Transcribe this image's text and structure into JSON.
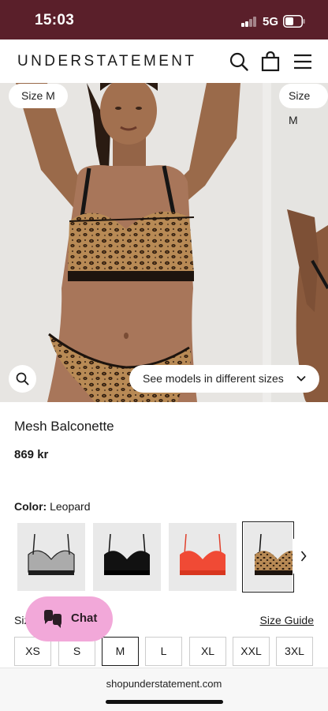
{
  "status_bar": {
    "time": "15:03",
    "network": "5G",
    "icons": [
      "signal-bars-icon",
      "battery-icon"
    ]
  },
  "header": {
    "brand": "UNDERSTATEMENT",
    "icons": [
      "search-icon",
      "shopping-bag-icon",
      "hamburger-menu-icon"
    ]
  },
  "gallery": {
    "slides": [
      {
        "size_tag": "Size M",
        "image": "model wearing leopard mesh balconette bra and briefs"
      },
      {
        "size_tag": "Size M",
        "image": "second model (partially visible)"
      }
    ],
    "zoom_icon": "magnifier-icon",
    "models_button": "See models in different sizes",
    "models_button_icon": "chevron-down-icon"
  },
  "product": {
    "name": "Mesh Balconette",
    "price": "869 kr",
    "color_label": "Color:",
    "color_value": "Leopard",
    "colors": [
      {
        "name": "Smoke",
        "hex": "#3a3a3a"
      },
      {
        "name": "Black",
        "hex": "#111111"
      },
      {
        "name": "Red",
        "hex": "#f04a35"
      },
      {
        "name": "Leopard",
        "hex": "#b07c48",
        "selected": true
      }
    ],
    "next_icon": "chevron-right-icon",
    "size_label": "Size",
    "size_guide": "Size Guide",
    "sizes": [
      "XS",
      "S",
      "M",
      "L",
      "XL",
      "XXL",
      "3XL"
    ],
    "selected_size": "M"
  },
  "chat": {
    "label": "Chat",
    "icon": "chat-bubbles-icon",
    "color": "#f2a8d9"
  },
  "browser": {
    "url": "shopunderstatement.com"
  }
}
